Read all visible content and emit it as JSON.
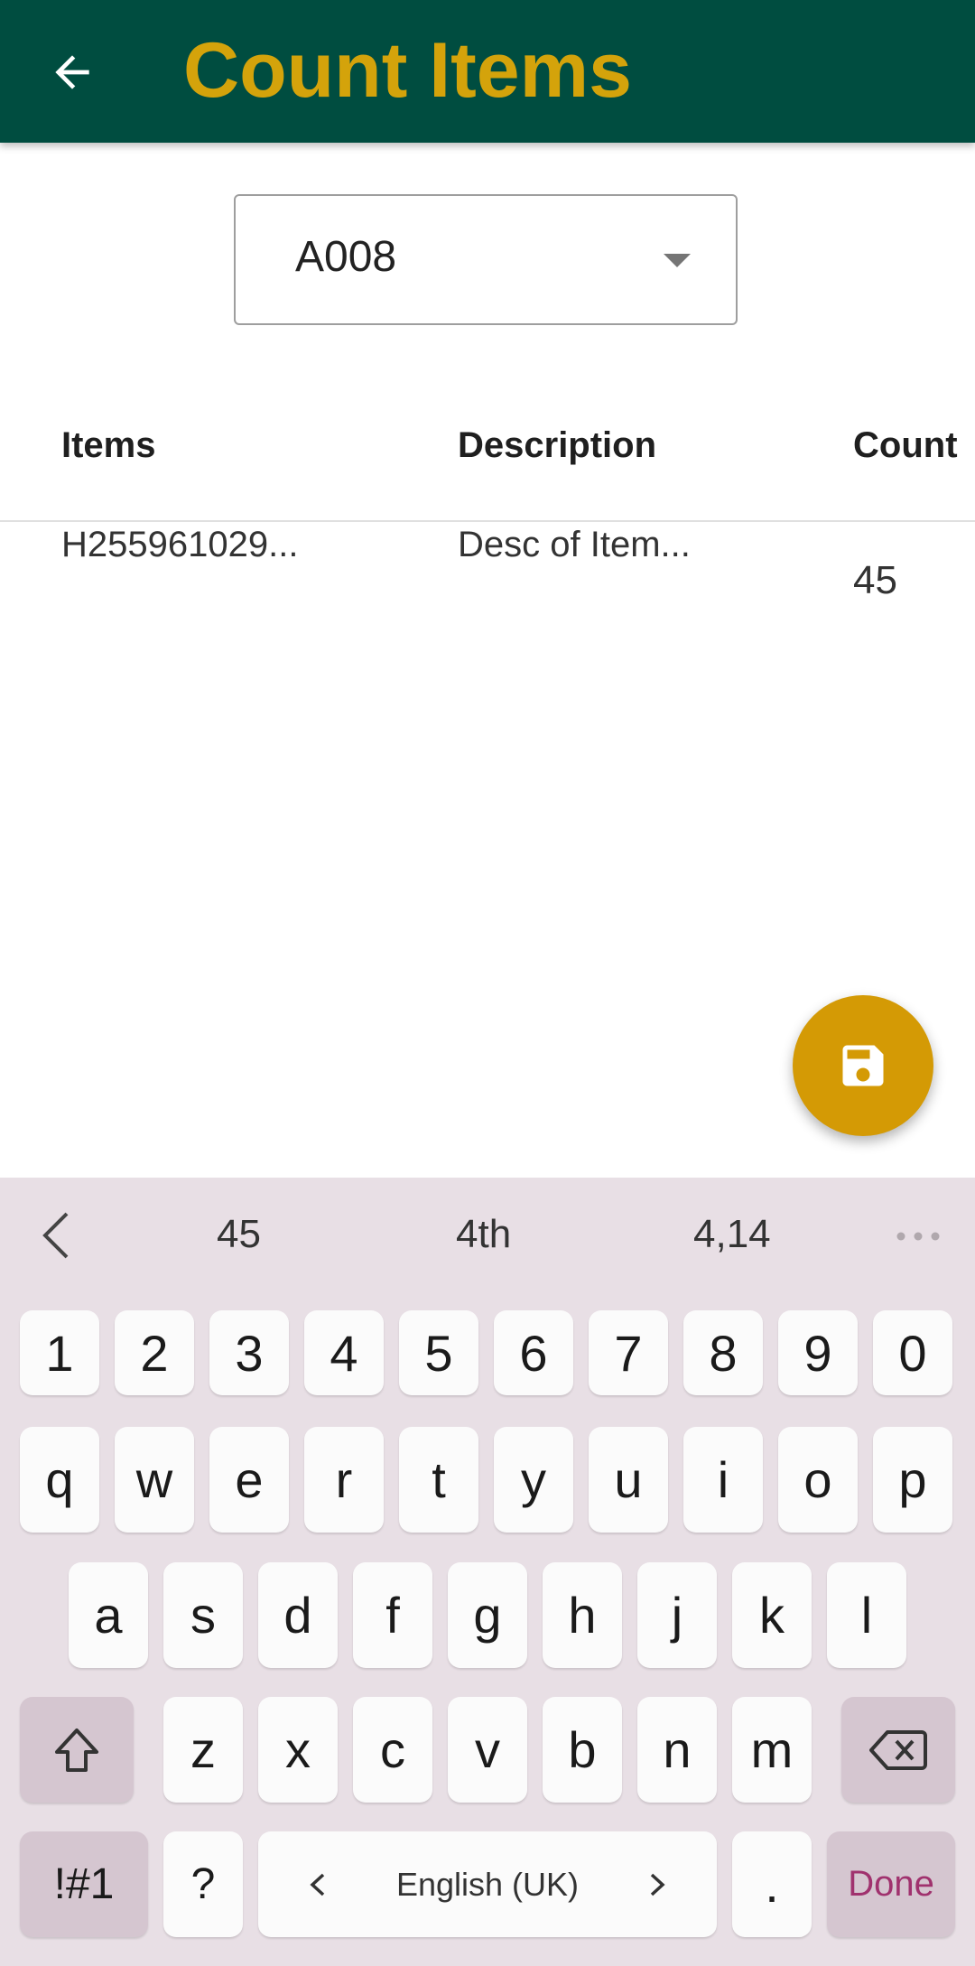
{
  "appbar": {
    "title": "Count Items",
    "back_icon": "arrow-back-icon",
    "bg_color": "#004d40",
    "title_color": "#d4a30b"
  },
  "location_select": {
    "value": "A008"
  },
  "table": {
    "headers": {
      "items": "Items",
      "description": "Description",
      "count": "Count"
    },
    "rows": [
      {
        "item": "H255961029...",
        "description": "Desc of Item...",
        "count": "45"
      }
    ]
  },
  "fab": {
    "icon": "save-icon",
    "color": "#d49a05"
  },
  "keyboard": {
    "suggestions": [
      "45",
      "4th",
      "4,14"
    ],
    "row_numbers": [
      "1",
      "2",
      "3",
      "4",
      "5",
      "6",
      "7",
      "8",
      "9",
      "0"
    ],
    "row_top": [
      "q",
      "w",
      "e",
      "r",
      "t",
      "y",
      "u",
      "i",
      "o",
      "p"
    ],
    "row_mid": [
      "a",
      "s",
      "d",
      "f",
      "g",
      "h",
      "j",
      "k",
      "l"
    ],
    "row_bottom": [
      "z",
      "x",
      "c",
      "v",
      "b",
      "n",
      "m"
    ],
    "symbols_label": "!#1",
    "question_label": "?",
    "language_label": "English (UK)",
    "period_label": ".",
    "done_label": "Done"
  }
}
